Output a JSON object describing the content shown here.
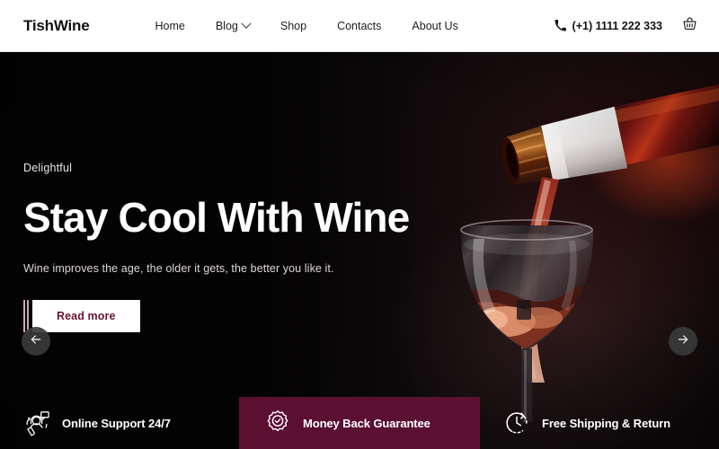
{
  "brand": {
    "name": "TishWine"
  },
  "nav": {
    "items": [
      {
        "label": "Home",
        "icon": null,
        "name": "nav-item-home"
      },
      {
        "label": "Blog",
        "icon": "chevron-down-icon",
        "name": "nav-item-blog"
      },
      {
        "label": "Shop",
        "icon": null,
        "name": "nav-item-shop"
      },
      {
        "label": "Contacts",
        "icon": null,
        "name": "nav-item-contacts"
      },
      {
        "label": "About Us",
        "icon": null,
        "name": "nav-item-about-us"
      }
    ]
  },
  "header": {
    "phone_icon": "phone-icon",
    "phone": "(+1) 1111 222 333",
    "cart_icon": "shopping-basket-icon"
  },
  "hero": {
    "eyebrow": "Delightful",
    "headline": "Stay Cool With Wine",
    "subline": "Wine improves the age, the older it gets, the better you like it.",
    "cta_label": "Read more",
    "prev_icon": "arrow-left-icon",
    "next_icon": "arrow-right-icon",
    "image_alt": "Red wine pouring from bottle into a wine glass"
  },
  "features": [
    {
      "icon": "support-headset-icon",
      "label": "Online Support 24/7",
      "highlighted": false
    },
    {
      "icon": "badge-check-icon",
      "label": "Money Back Guarantee",
      "highlighted": true
    },
    {
      "icon": "clock-arrow-icon",
      "label": "Free Shipping & Return",
      "highlighted": false
    }
  ],
  "colors": {
    "accent": "#5b1032",
    "accent_text": "#6b1433",
    "header_bg": "#ffffff",
    "hero_bg": "#060405",
    "text_light": "#ffffff"
  }
}
